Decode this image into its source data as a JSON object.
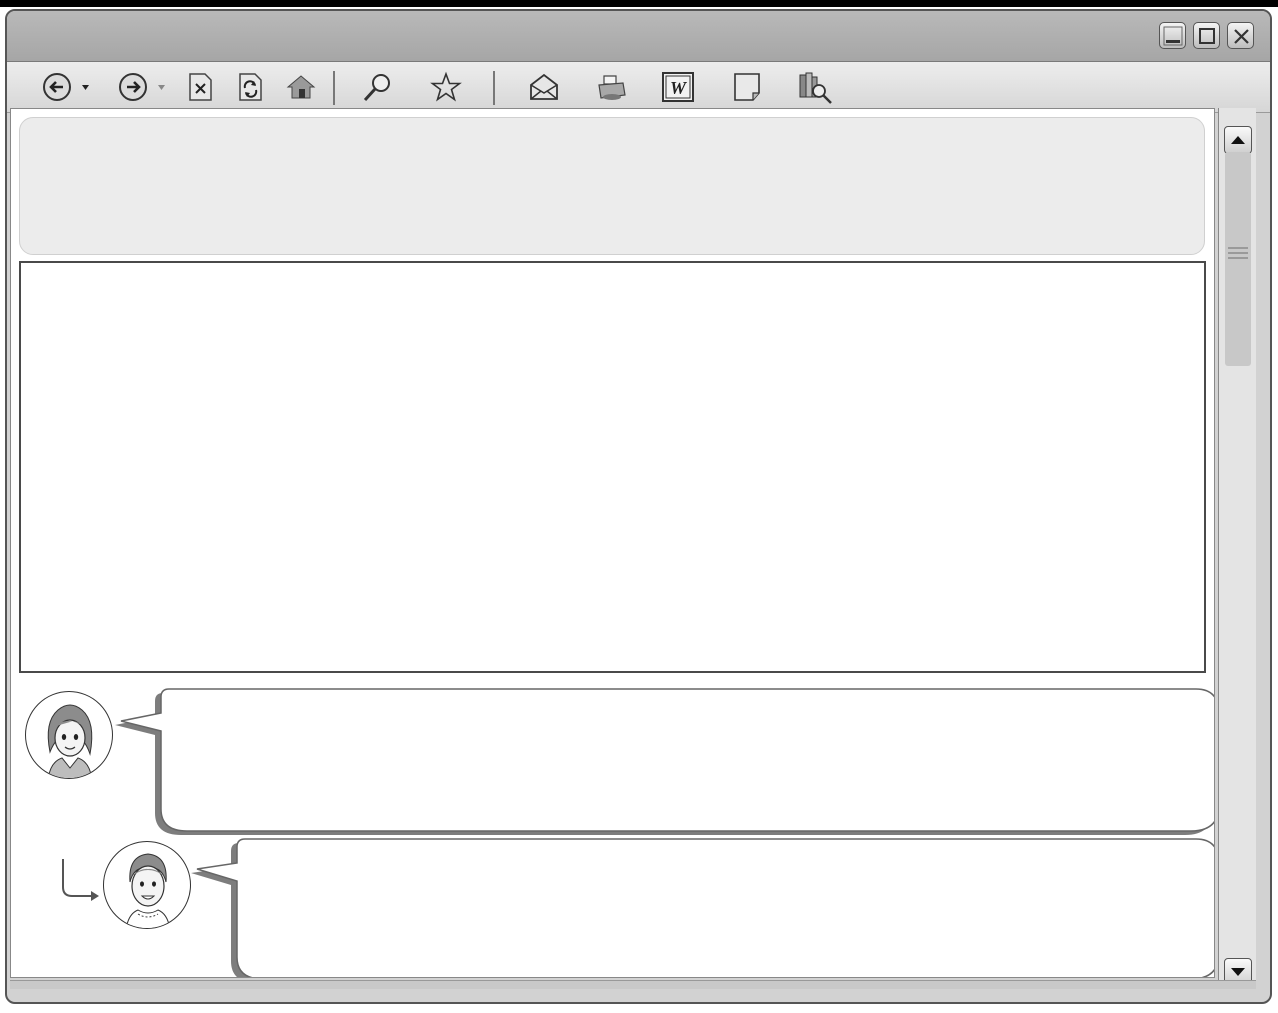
{
  "window": {
    "controls": {
      "minimize_icon": "minimize-icon",
      "maximize_icon": "maximize-icon",
      "close_icon": "close-icon"
    }
  },
  "toolbar": {
    "buttons": [
      {
        "name": "back-button",
        "icon": "back-arrow-icon",
        "has_dropdown": true
      },
      {
        "name": "forward-button",
        "icon": "forward-arrow-icon",
        "has_dropdown": true
      },
      {
        "name": "stop-button",
        "icon": "stop-icon"
      },
      {
        "name": "refresh-button",
        "icon": "refresh-icon"
      },
      {
        "name": "home-button",
        "icon": "home-icon"
      },
      {
        "name": "search-button",
        "icon": "magnifier-icon"
      },
      {
        "name": "favorites-button",
        "icon": "star-icon"
      },
      {
        "name": "mail-button",
        "icon": "envelope-icon"
      },
      {
        "name": "print-button",
        "icon": "printer-icon"
      },
      {
        "name": "word-button",
        "icon": "word-icon",
        "glyph": "W"
      },
      {
        "name": "note-button",
        "icon": "note-icon"
      },
      {
        "name": "research-button",
        "icon": "books-search-icon"
      }
    ]
  },
  "colors": {
    "frame": "#d2d2d2",
    "header_panel": "#ececec",
    "bubble_shadow": "#7d7d7d"
  },
  "conversation": {
    "speakers": [
      {
        "name": "speaker-woman",
        "avatar_icon": "woman-avatar-icon",
        "text": ""
      },
      {
        "name": "speaker-man",
        "avatar_icon": "man-avatar-icon",
        "text": ""
      }
    ]
  }
}
